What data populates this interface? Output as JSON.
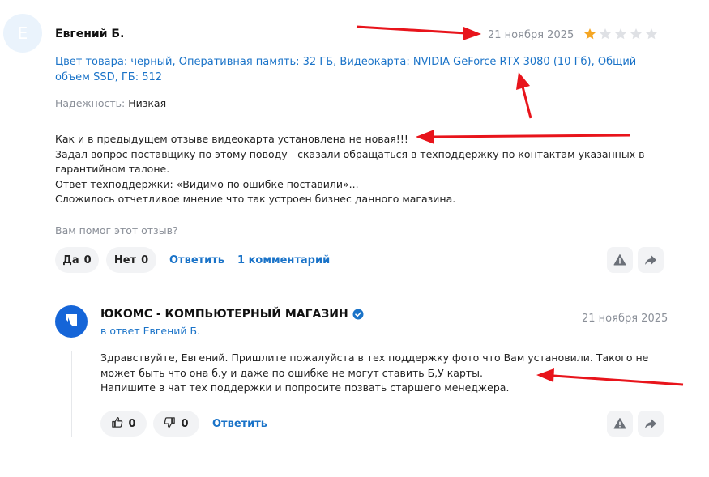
{
  "review": {
    "avatar_letter": "Е",
    "author": "Евгений Б.",
    "date": "21 ноября 2025",
    "rating": 1,
    "max_rating": 5,
    "specs": "Цвет товара: черный, Оперативная память: 32 ГБ, Видеокарта: NVIDIA GeForce RTX 3080 (10 Гб), Общий объем SSD, ГБ: 512",
    "reliability_label": "Надежность:",
    "reliability_value": "Низкая",
    "text_lines": [
      "Как и в предыдущем отзыве видеокарта установлена не новая!!!",
      "Задал вопрос поставщику по этому поводу - сказали обращаться в техподдержку по контактам указанных в гарантийном талоне.",
      "Ответ техподдержки: «Видимо по ошибке поставили»...",
      "Сложилось отчетливое мнение что так устроен бизнес данного магазина."
    ],
    "helpful_question": "Вам помог этот отзыв?",
    "yes_label": "Да",
    "yes_count": "0",
    "no_label": "Нет",
    "no_count": "0",
    "reply_label": "Ответить",
    "comments_label": "1 комментарий"
  },
  "reply": {
    "shop_name": "ЮКОМС - КОМПЬЮТЕРНЫЙ МАГАЗИН",
    "reply_to": "в ответ Евгений Б.",
    "date": "21 ноября 2025",
    "text_lines": [
      "Здравствуйте, Евгений. Пришлите пожалуйста в тех поддержку фото что Вам установили. Такого не может быть что она б.у и даже по ошибке не могут ставить Б,У карты.",
      "Напишите в чат тех поддержки и попросите позвать старшего менеджера."
    ],
    "likes": "0",
    "dislikes": "0",
    "reply_label": "Ответить"
  },
  "colors": {
    "accent": "#1a73c8",
    "star_filled": "#f5a623",
    "star_empty": "#dfe1e5",
    "annotation_arrow": "#e8141b"
  },
  "icons": [
    "star-icon",
    "warning-icon",
    "share-icon",
    "verified-icon",
    "thumbs-up-icon",
    "thumbs-down-icon",
    "shop-logo-icon"
  ]
}
